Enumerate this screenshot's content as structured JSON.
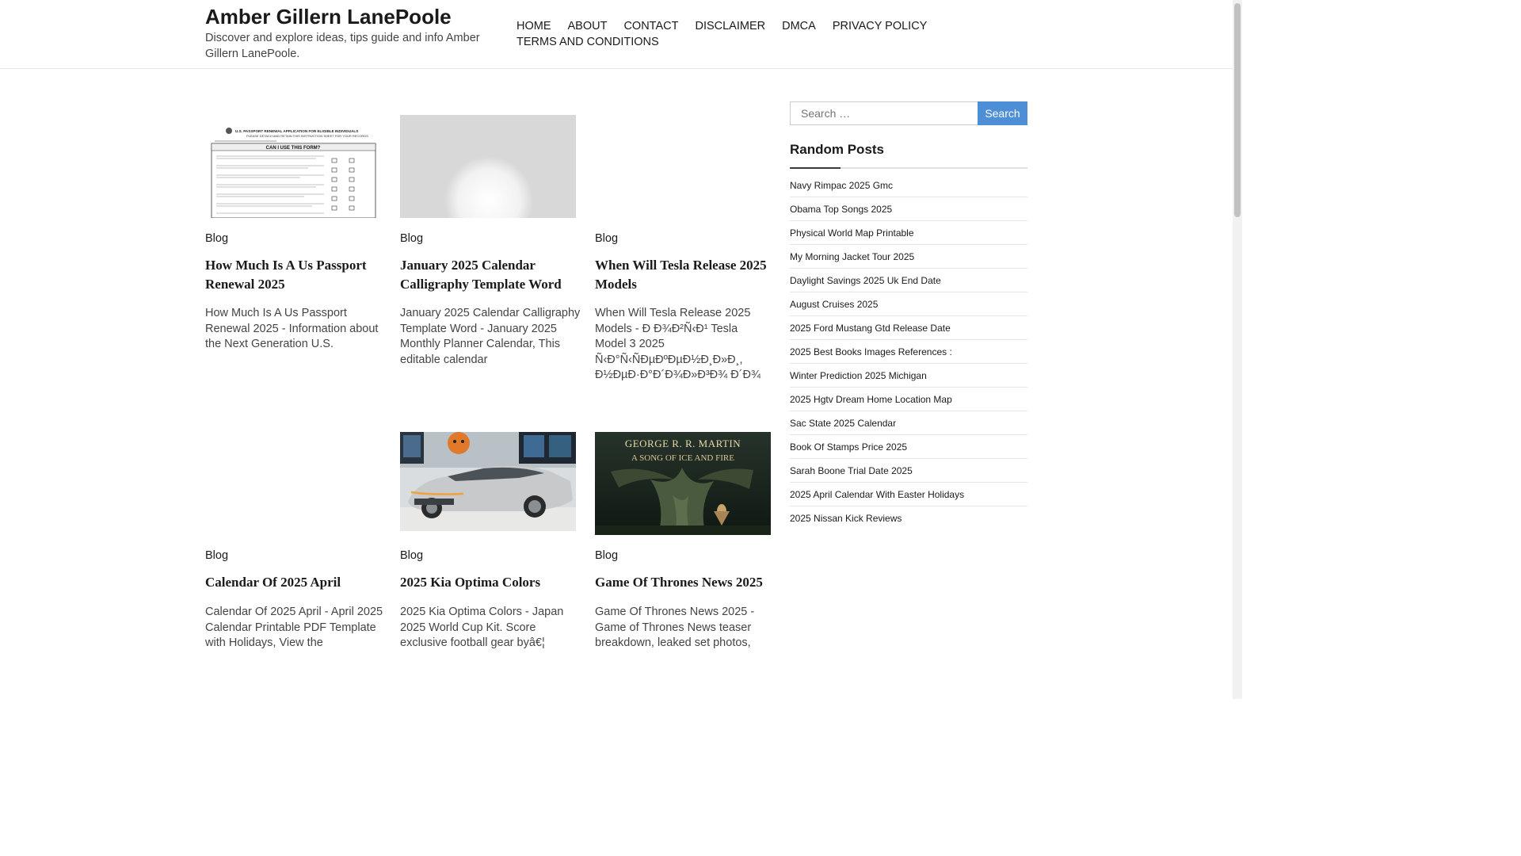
{
  "site": {
    "title": "Amber Gillern LanePoole",
    "description": "Discover and explore ideas, tips guide and info Amber Gillern LanePoole."
  },
  "nav": {
    "items": [
      "HOME",
      "ABOUT",
      "CONTACT",
      "DISCLAIMER",
      "DMCA",
      "PRIVACY POLICY",
      "TERMS AND CONDITIONS"
    ]
  },
  "posts": [
    {
      "category": "Blog",
      "title": "How Much Is A Us Passport Renewal 2025",
      "excerpt": "How Much Is A Us Passport Renewal 2025 - Information about the Next Generation U.S.",
      "image": "passport-form",
      "image_text": {
        "heading": "U.S. PASSPORT RENEWAL APPLICATION FOR ELIGIBLE INDIVIDUALS",
        "subheading": "PLEASE DETACH AND RETAIN THIS INSTRUCTION SHEET FOR YOUR RECORDS",
        "question": "CAN I USE THIS FORM?"
      }
    },
    {
      "category": "Blog",
      "title": "January 2025 Calendar Calligraphy Template Word",
      "excerpt": "January 2025 Calendar Calligraphy Template Word - January 2025 Monthly Planner Calendar, This editable calendar",
      "image": "blurred-placeholder"
    },
    {
      "category": "Blog",
      "title": "When Will Tesla Release 2025 Models",
      "excerpt": "When Will Tesla Release 2025 Models - Ð    Ð¾Ð²Ñ‹Ð¹ Tesla Model 3 2025 Ñ‹Ð°Ñ‹ÑÐµÐºÐµÐ½Ð¸Ð»Ð¸, Ð½ÐµÐ·Ð°Ð´Ð¾Ð»Ð³Ð¾ Ð´Ð¾",
      "image": "none"
    },
    {
      "category": "Blog",
      "title": "Calendar Of 2025 April",
      "excerpt": "Calendar Of 2025 April - April 2025 Calendar Printable PDF Template with Holidays, View the",
      "image": "none"
    },
    {
      "category": "Blog",
      "title": "2025 Kia Optima Colors",
      "excerpt": "2025 Kia Optima Colors - Japan 2025 World Cup Kit. Score exclusive football gear byâ€¦",
      "image": "kia-car"
    },
    {
      "category": "Blog",
      "title": "Game Of Thrones News 2025",
      "excerpt": "Game Of Thrones News 2025 - Game of Thrones News teaser breakdown, leaked set photos,",
      "image": "book-cover",
      "image_text": {
        "author": "GEORGE R. R. MARTIN",
        "series": "A SONG OF ICE AND FIRE"
      }
    }
  ],
  "search": {
    "placeholder": "Search …",
    "button_label": "Search"
  },
  "random_posts": {
    "title": "Random Posts",
    "items": [
      "Navy Rimpac 2025 Gmc",
      "Obama Top Songs 2025",
      "Physical World Map Printable",
      "My Morning Jacket Tour 2025",
      "Daylight Savings 2025 Uk End Date",
      "August Cruises 2025",
      "2025 Ford Mustang Gtd Release Date",
      "2025 Best Books Images References :",
      "Winter Prediction 2025 Michigan",
      "2025 Hgtv Dream Home Location Map",
      "Sac State 2025 Calendar",
      "Book Of Stamps Price 2025",
      "Sarah Boone Trial Date 2025",
      "2025 April Calendar With Easter Holidays",
      "2025 Nissan Kick Reviews"
    ]
  },
  "colors": {
    "accent": "#4d8ed6",
    "text": "#1a1a1a",
    "border": "#e6e6e6"
  }
}
